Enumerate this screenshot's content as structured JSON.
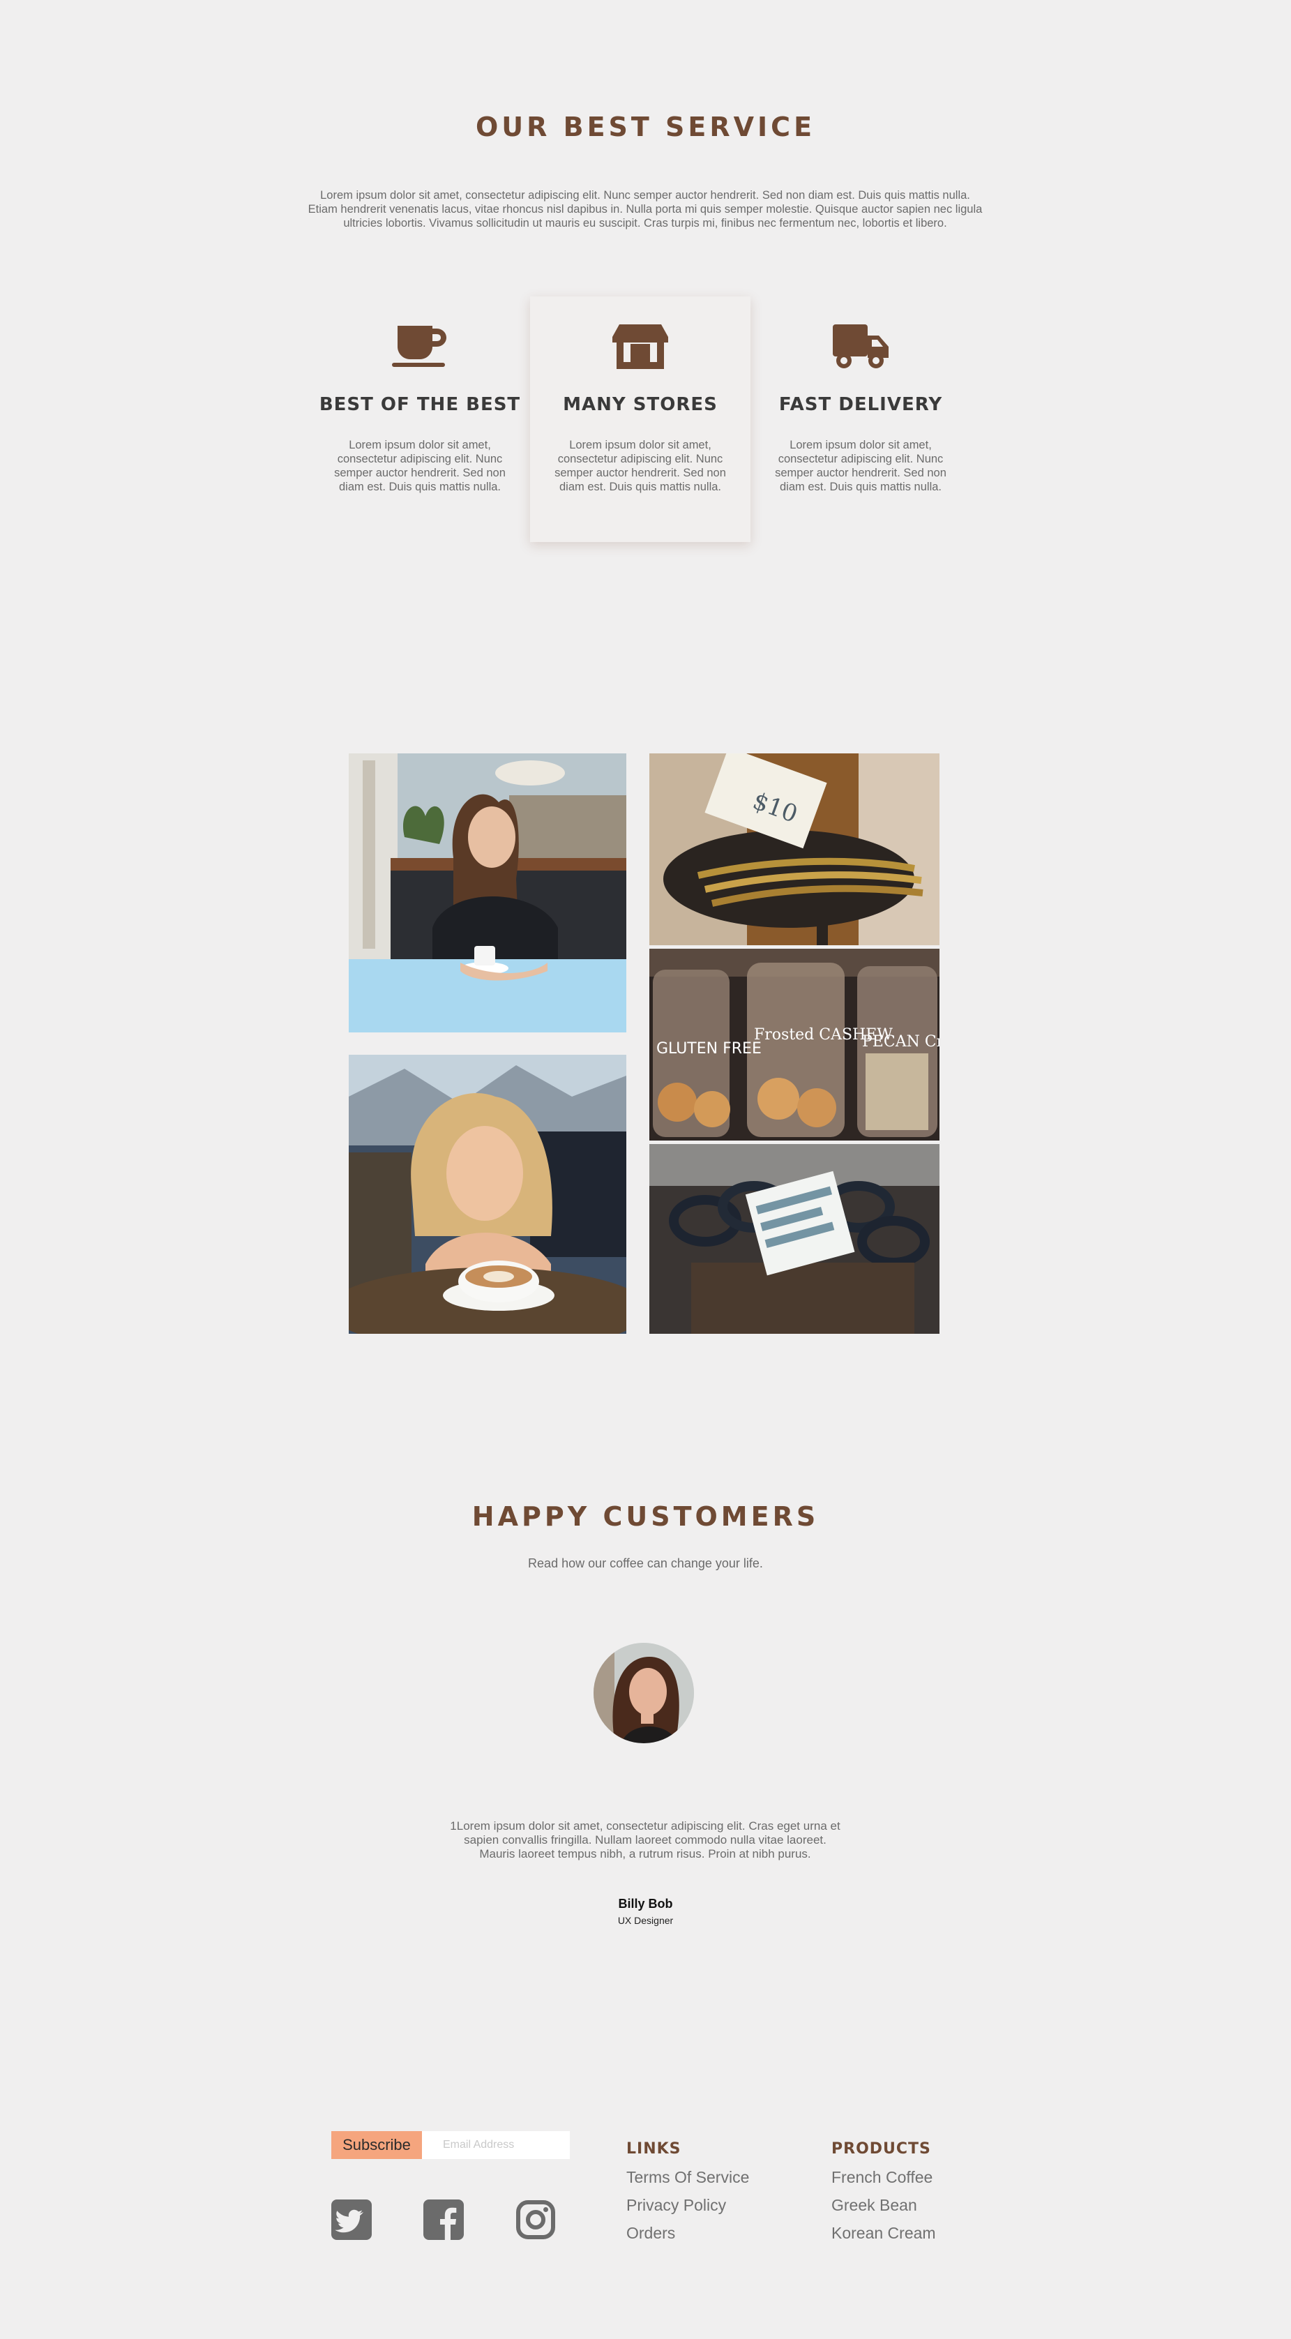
{
  "service": {
    "title": "OUR BEST SERVICE",
    "intro": "Lorem ipsum dolor sit amet, consectetur adipiscing elit. Nunc semper auctor hendrerit. Sed non diam est. Duis quis mattis nulla. Etiam hendrerit venenatis lacus, vitae rhoncus nisl dapibus in. Nulla porta mi quis semper molestie. Quisque auctor sapien nec ligula ultricies lobortis. Vivamus sollicitudin ut mauris eu suscipit. Cras turpis mi, finibus nec fermentum nec, lobortis et libero.",
    "cards": [
      {
        "icon": "coffee-cup-icon",
        "title": "BEST OF THE BEST",
        "text": "Lorem ipsum dolor sit amet, consectetur adipiscing elit. Nunc semper auctor hendrerit. Sed non diam est. Duis quis mattis nulla."
      },
      {
        "icon": "store-icon",
        "title": "MANY STORES",
        "text": "Lorem ipsum dolor sit amet, consectetur adipiscing elit. Nunc semper auctor hendrerit. Sed non diam est. Duis quis mattis nulla."
      },
      {
        "icon": "delivery-truck-icon",
        "title": "FAST DELIVERY",
        "text": "Lorem ipsum dolor sit amet, consectetur adipiscing elit. Nunc semper auctor hendrerit. Sed non diam est. Duis quis mattis nulla."
      }
    ]
  },
  "gallery": {
    "photos": [
      "woman-in-cafe-photo",
      "spoons-price-tag-photo",
      "cookie-jars-photo",
      "smiling-woman-latte-photo",
      "scissors-price-tag-photo"
    ],
    "tags": {
      "spoons": "$10",
      "jar_left": "GLUTEN FREE",
      "jar_middle": "Frosted CASHEW",
      "jar_right": "PECAN Crisps"
    }
  },
  "customers": {
    "title": "HAPPY CUSTOMERS",
    "subtitle": "Read how our coffee can change your life.",
    "quote": "1Lorem ipsum dolor sit amet, consectetur adipiscing elit. Cras eget urna et sapien convallis fringilla. Nullam laoreet commodo nulla vitae laoreet. Mauris laoreet tempus nibh, a rutrum risus. Proin at nibh purus.",
    "name": "Billy Bob",
    "role": "UX Designer"
  },
  "footer": {
    "subscribe_label": "Subscribe",
    "email_placeholder": "Email Address",
    "social": [
      "twitter-icon",
      "facebook-icon",
      "instagram-icon"
    ],
    "links_title": "LINKS",
    "links": [
      "Terms Of Service",
      "Privacy Policy",
      "Orders"
    ],
    "products_title": "PRODUCTS",
    "products": [
      "French Coffee",
      "Greek Bean",
      "Korean Cream"
    ]
  },
  "colors": {
    "accent": "#6f4a34",
    "background": "#f0efef",
    "subscribe_button": "#f5a57e",
    "text": "#6b6b6b"
  }
}
